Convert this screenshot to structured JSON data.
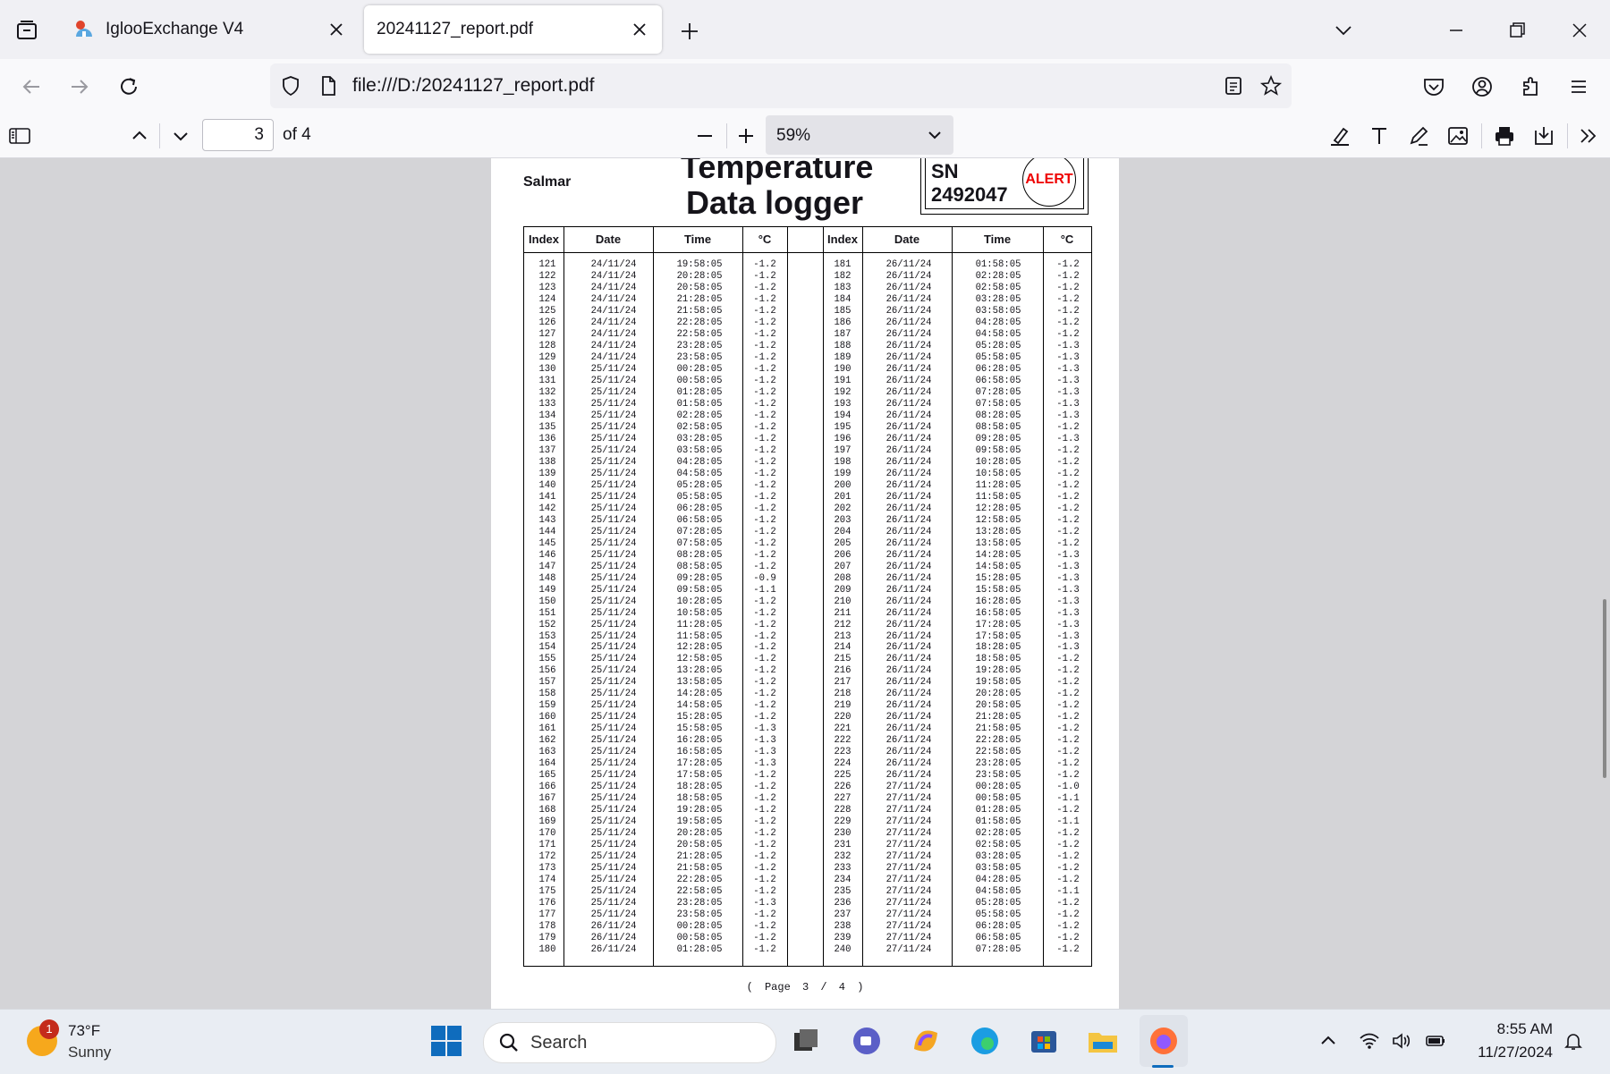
{
  "tabs": [
    {
      "title": "IglooExchange V4",
      "active": false
    },
    {
      "title": "20241127_report.pdf",
      "active": true
    }
  ],
  "navbar": {
    "url": "file:///D:/20241127_report.pdf"
  },
  "pdf_toolbar": {
    "page": "3",
    "page_of": "of 4",
    "zoom": "59%"
  },
  "document": {
    "company": "Salmar",
    "title_line1": "Temperature",
    "title_line2": "Data logger",
    "sn_label": "SN",
    "sn_value": "2492047",
    "alert": "ALERT",
    "headers": [
      "Index",
      "Date",
      "Time",
      "°C",
      "Index",
      "Date",
      "Time",
      "°C"
    ],
    "left": {
      "index": [
        "121",
        "122",
        "123",
        "124",
        "125",
        "126",
        "127",
        "128",
        "129",
        "130",
        "131",
        "132",
        "133",
        "134",
        "135",
        "136",
        "137",
        "138",
        "139",
        "140",
        "141",
        "142",
        "143",
        "144",
        "145",
        "146",
        "147",
        "148",
        "149",
        "150",
        "151",
        "152",
        "153",
        "154",
        "155",
        "156",
        "157",
        "158",
        "159",
        "160",
        "161",
        "162",
        "163",
        "164",
        "165",
        "166",
        "167",
        "168",
        "169",
        "170",
        "171",
        "172",
        "173",
        "174",
        "175",
        "176",
        "177",
        "178",
        "179",
        "180"
      ],
      "date": [
        "24/11/24",
        "24/11/24",
        "24/11/24",
        "24/11/24",
        "24/11/24",
        "24/11/24",
        "24/11/24",
        "24/11/24",
        "24/11/24",
        "25/11/24",
        "25/11/24",
        "25/11/24",
        "25/11/24",
        "25/11/24",
        "25/11/24",
        "25/11/24",
        "25/11/24",
        "25/11/24",
        "25/11/24",
        "25/11/24",
        "25/11/24",
        "25/11/24",
        "25/11/24",
        "25/11/24",
        "25/11/24",
        "25/11/24",
        "25/11/24",
        "25/11/24",
        "25/11/24",
        "25/11/24",
        "25/11/24",
        "25/11/24",
        "25/11/24",
        "25/11/24",
        "25/11/24",
        "25/11/24",
        "25/11/24",
        "25/11/24",
        "25/11/24",
        "25/11/24",
        "25/11/24",
        "25/11/24",
        "25/11/24",
        "25/11/24",
        "25/11/24",
        "25/11/24",
        "25/11/24",
        "25/11/24",
        "25/11/24",
        "25/11/24",
        "25/11/24",
        "25/11/24",
        "25/11/24",
        "25/11/24",
        "25/11/24",
        "25/11/24",
        "25/11/24",
        "26/11/24",
        "26/11/24",
        "26/11/24"
      ],
      "time": [
        "19:58:05",
        "20:28:05",
        "20:58:05",
        "21:28:05",
        "21:58:05",
        "22:28:05",
        "22:58:05",
        "23:28:05",
        "23:58:05",
        "00:28:05",
        "00:58:05",
        "01:28:05",
        "01:58:05",
        "02:28:05",
        "02:58:05",
        "03:28:05",
        "03:58:05",
        "04:28:05",
        "04:58:05",
        "05:28:05",
        "05:58:05",
        "06:28:05",
        "06:58:05",
        "07:28:05",
        "07:58:05",
        "08:28:05",
        "08:58:05",
        "09:28:05",
        "09:58:05",
        "10:28:05",
        "10:58:05",
        "11:28:05",
        "11:58:05",
        "12:28:05",
        "12:58:05",
        "13:28:05",
        "13:58:05",
        "14:28:05",
        "14:58:05",
        "15:28:05",
        "15:58:05",
        "16:28:05",
        "16:58:05",
        "17:28:05",
        "17:58:05",
        "18:28:05",
        "18:58:05",
        "19:28:05",
        "19:58:05",
        "20:28:05",
        "20:58:05",
        "21:28:05",
        "21:58:05",
        "22:28:05",
        "22:58:05",
        "23:28:05",
        "23:58:05",
        "00:28:05",
        "00:58:05",
        "01:28:05"
      ],
      "temp": [
        "-1.2",
        "-1.2",
        "-1.2",
        "-1.2",
        "-1.2",
        "-1.2",
        "-1.2",
        "-1.2",
        "-1.2",
        "-1.2",
        "-1.2",
        "-1.2",
        "-1.2",
        "-1.2",
        "-1.2",
        "-1.2",
        "-1.2",
        "-1.2",
        "-1.2",
        "-1.2",
        "-1.2",
        "-1.2",
        "-1.2",
        "-1.2",
        "-1.2",
        "-1.2",
        "-1.2",
        "-0.9",
        "-1.1",
        "-1.2",
        "-1.2",
        "-1.2",
        "-1.2",
        "-1.2",
        "-1.2",
        "-1.2",
        "-1.2",
        "-1.2",
        "-1.2",
        "-1.2",
        "-1.3",
        "-1.3",
        "-1.3",
        "-1.3",
        "-1.2",
        "-1.2",
        "-1.2",
        "-1.2",
        "-1.2",
        "-1.2",
        "-1.2",
        "-1.2",
        "-1.2",
        "-1.2",
        "-1.2",
        "-1.3",
        "-1.2",
        "-1.2",
        "-1.2",
        "-1.2"
      ]
    },
    "right": {
      "index": [
        "181",
        "182",
        "183",
        "184",
        "185",
        "186",
        "187",
        "188",
        "189",
        "190",
        "191",
        "192",
        "193",
        "194",
        "195",
        "196",
        "197",
        "198",
        "199",
        "200",
        "201",
        "202",
        "203",
        "204",
        "205",
        "206",
        "207",
        "208",
        "209",
        "210",
        "211",
        "212",
        "213",
        "214",
        "215",
        "216",
        "217",
        "218",
        "219",
        "220",
        "221",
        "222",
        "223",
        "224",
        "225",
        "226",
        "227",
        "228",
        "229",
        "230",
        "231",
        "232",
        "233",
        "234",
        "235",
        "236",
        "237",
        "238",
        "239",
        "240"
      ],
      "date": [
        "26/11/24",
        "26/11/24",
        "26/11/24",
        "26/11/24",
        "26/11/24",
        "26/11/24",
        "26/11/24",
        "26/11/24",
        "26/11/24",
        "26/11/24",
        "26/11/24",
        "26/11/24",
        "26/11/24",
        "26/11/24",
        "26/11/24",
        "26/11/24",
        "26/11/24",
        "26/11/24",
        "26/11/24",
        "26/11/24",
        "26/11/24",
        "26/11/24",
        "26/11/24",
        "26/11/24",
        "26/11/24",
        "26/11/24",
        "26/11/24",
        "26/11/24",
        "26/11/24",
        "26/11/24",
        "26/11/24",
        "26/11/24",
        "26/11/24",
        "26/11/24",
        "26/11/24",
        "26/11/24",
        "26/11/24",
        "26/11/24",
        "26/11/24",
        "26/11/24",
        "26/11/24",
        "26/11/24",
        "26/11/24",
        "26/11/24",
        "26/11/24",
        "27/11/24",
        "27/11/24",
        "27/11/24",
        "27/11/24",
        "27/11/24",
        "27/11/24",
        "27/11/24",
        "27/11/24",
        "27/11/24",
        "27/11/24",
        "27/11/24",
        "27/11/24",
        "27/11/24",
        "27/11/24",
        "27/11/24"
      ],
      "time": [
        "01:58:05",
        "02:28:05",
        "02:58:05",
        "03:28:05",
        "03:58:05",
        "04:28:05",
        "04:58:05",
        "05:28:05",
        "05:58:05",
        "06:28:05",
        "06:58:05",
        "07:28:05",
        "07:58:05",
        "08:28:05",
        "08:58:05",
        "09:28:05",
        "09:58:05",
        "10:28:05",
        "10:58:05",
        "11:28:05",
        "11:58:05",
        "12:28:05",
        "12:58:05",
        "13:28:05",
        "13:58:05",
        "14:28:05",
        "14:58:05",
        "15:28:05",
        "15:58:05",
        "16:28:05",
        "16:58:05",
        "17:28:05",
        "17:58:05",
        "18:28:05",
        "18:58:05",
        "19:28:05",
        "19:58:05",
        "20:28:05",
        "20:58:05",
        "21:28:05",
        "21:58:05",
        "22:28:05",
        "22:58:05",
        "23:28:05",
        "23:58:05",
        "00:28:05",
        "00:58:05",
        "01:28:05",
        "01:58:05",
        "02:28:05",
        "02:58:05",
        "03:28:05",
        "03:58:05",
        "04:28:05",
        "04:58:05",
        "05:28:05",
        "05:58:05",
        "06:28:05",
        "06:58:05",
        "07:28:05"
      ],
      "temp": [
        "-1.2",
        "-1.2",
        "-1.2",
        "-1.2",
        "-1.2",
        "-1.2",
        "-1.2",
        "-1.3",
        "-1.3",
        "-1.3",
        "-1.3",
        "-1.3",
        "-1.3",
        "-1.3",
        "-1.2",
        "-1.3",
        "-1.2",
        "-1.2",
        "-1.2",
        "-1.2",
        "-1.2",
        "-1.2",
        "-1.2",
        "-1.2",
        "-1.2",
        "-1.3",
        "-1.3",
        "-1.3",
        "-1.3",
        "-1.3",
        "-1.3",
        "-1.3",
        "-1.3",
        "-1.3",
        "-1.2",
        "-1.2",
        "-1.2",
        "-1.2",
        "-1.2",
        "-1.2",
        "-1.2",
        "-1.2",
        "-1.2",
        "-1.2",
        "-1.2",
        "-1.0",
        "-1.1",
        "-1.2",
        "-1.1",
        "-1.2",
        "-1.2",
        "-1.2",
        "-1.2",
        "-1.2",
        "-1.1",
        "-1.2",
        "-1.2",
        "-1.2",
        "-1.2",
        "-1.2"
      ]
    },
    "footer": "( Page 3 / 4 )"
  },
  "taskbar": {
    "weather_temp": "73°F",
    "weather_cond": "Sunny",
    "weather_badge": "1",
    "search": "Search",
    "time": "8:55 AM",
    "date": "11/27/2024"
  }
}
